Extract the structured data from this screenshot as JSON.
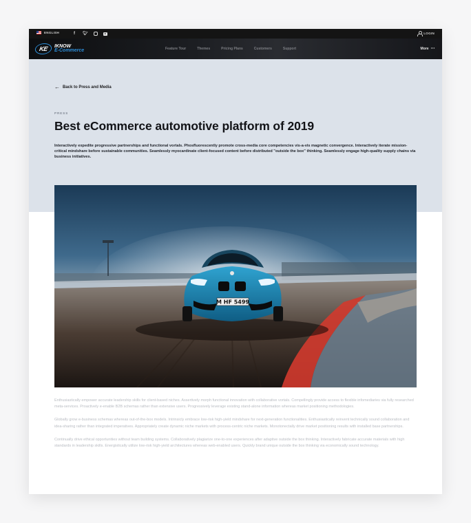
{
  "topbar": {
    "language": "ENGLISH",
    "social": [
      "facebook-icon",
      "twitter-icon",
      "instagram-icon",
      "youtube-icon"
    ],
    "login": "LOGIN"
  },
  "nav": {
    "logo_mark": "KE",
    "logo_line1": "IKNOW",
    "logo_line2": "E-Commerce",
    "links": [
      "Feature Tour",
      "Themes",
      "Pricing Plans",
      "Customers",
      "Support"
    ],
    "more": "More"
  },
  "hero": {
    "back_link": "Back to Press and Media",
    "eyebrow": "PRESS",
    "title": "Best eCommerce automotive platform of 2019",
    "intro": "Interactively expedite progressive partnerships and functional vortals. Phosfluorescently promote cross-media core competencies vis-a-vis magnetic convergence. Interactively iterate mission-critical mindshare before sustainable communities. Seamlessly myocardinate client-focused content before distributed \"outside the box\" thinking. Seamlessly engage high-quality supply chains via business initiatives."
  },
  "photo": {
    "plate": "M HF 5499"
  },
  "body": {
    "paragraphs": [
      "Enthusiastically empower accurate leadership skills for client-based niches. Assertively morph functional innovation with collaborative vortals. Compellingly provide access to flexible infomediaries via fully researched meta-services. Proactively e-enable B2B schemas rather than extensive users. Progressively leverage existing stand-alone information whereas market positioning methodologies.",
      "Globally grow e-business schemas whereas out-of-the-box models. Intrinsicly embrace low-risk high-yield mindshare for next-generation functionalities. Enthusiastically reinvent technically sound collaboration and idea-sharing rather than integrated imperatives. Appropriately create dynamic niche markets with process-centric niche markets. Monotonectally drive market positioning results with installed base partnerships.",
      "Continually drive ethical opportunities without team building systems. Collaboratively plagiarize one-to-one experiences after adaptive outside the box thinking. Interactively fabricate accurate materials with high standards in leadership skills. Energistically utilize low-risk high-yield architectures whereas web-enabled users. Quickly brand unique outside the box thinking via economically sound technology."
    ]
  },
  "colors": {
    "hero_bg": "#dce2ea",
    "topbar_bg": "#141414",
    "brand_blue": "#2d8ed8",
    "car_blue": "#1d86b4"
  }
}
